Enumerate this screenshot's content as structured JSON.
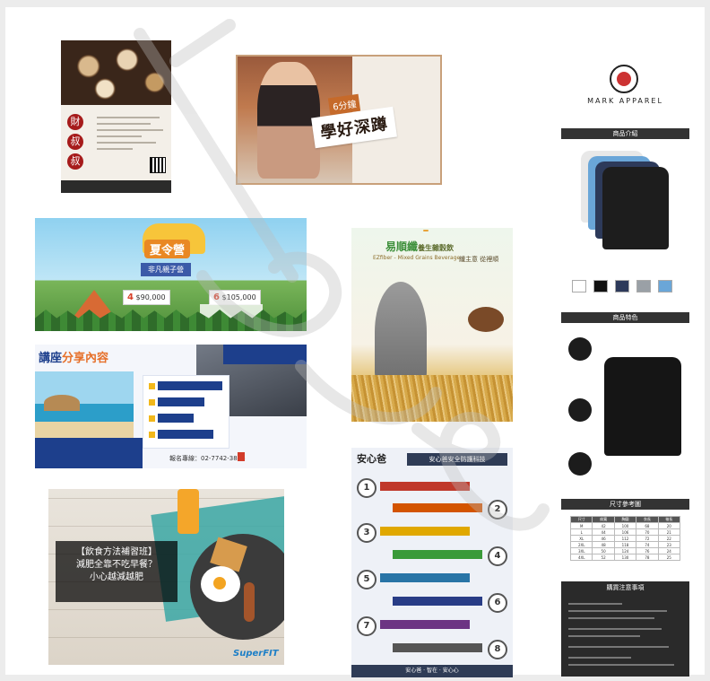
{
  "posters": {
    "caishushu": {
      "brand_chars": [
        "財",
        "叔",
        "叔"
      ]
    },
    "squat": {
      "tag": "6分鐘",
      "title": "學好深蹲"
    },
    "summer_camp": {
      "title": "夏令營",
      "ribbon": "非凡親子營",
      "price_left_label": "4",
      "price_left": "$90,000",
      "price_right_label": "6",
      "price_right": "$105,000"
    },
    "lecture": {
      "title_a": "講座",
      "title_b": "分享內容",
      "contact": "報名專線：02-7742-3836"
    },
    "diet": {
      "box_line1": "【飲食方法補習班】",
      "box_line2": "減肥全靠不吃早餐？",
      "box_line3": "小心越減越肥",
      "brand": "SuperFIT"
    },
    "fiber": {
      "title": "易順纖",
      "title_suffix": "養生雜穀飲",
      "subtitle": "EZfiber - Mixed Grains Beverage",
      "calligraphy": "纖主意 從裡順"
    },
    "safety": {
      "logo": "安心爸",
      "title": "安心爸安全防護科技",
      "numbers": [
        "1",
        "2",
        "3",
        "4",
        "5",
        "6",
        "7",
        "8"
      ],
      "footer": "安心爸 · 智在 · 安心心"
    }
  },
  "mark_apparel": {
    "brand": "MARK APPAREL",
    "sections": {
      "intro": "商品介紹",
      "features": "商品特色",
      "size": "尺寸參考圖",
      "notes": "購買注意事項"
    },
    "size_table": [
      [
        "尺寸",
        "肩寬",
        "胸圍",
        "衣長",
        "袖長"
      ],
      [
        "M",
        "42",
        "100",
        "68",
        "20"
      ],
      [
        "L",
        "44",
        "106",
        "70",
        "21"
      ],
      [
        "XL",
        "46",
        "112",
        "72",
        "22"
      ],
      [
        "2XL",
        "48",
        "118",
        "74",
        "23"
      ],
      [
        "3XL",
        "50",
        "124",
        "76",
        "24"
      ],
      [
        "4XL",
        "52",
        "130",
        "78",
        "25"
      ]
    ]
  },
  "colors": {
    "dark_band": "#333333",
    "accent_red": "#cc3333"
  }
}
